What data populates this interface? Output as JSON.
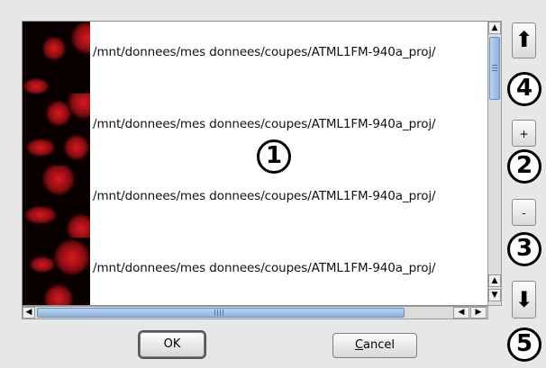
{
  "file_list": {
    "rows": [
      {
        "path": "/mnt/donnees/mes donnees/coupes/ATML1FM-940a_proj/"
      },
      {
        "path": "/mnt/donnees/mes donnees/coupes/ATML1FM-940a_proj/"
      },
      {
        "path": "/mnt/donnees/mes donnees/coupes/ATML1FM-940a_proj/"
      },
      {
        "path": "/mnt/donnees/mes donnees/coupes/ATML1FM-940a_proj/"
      }
    ]
  },
  "side_buttons": {
    "move_up": "⬆",
    "zoom_in": "+",
    "zoom_out": "-",
    "move_down": "⬇"
  },
  "callouts": [
    "1",
    "2",
    "3",
    "4",
    "5"
  ],
  "dialog": {
    "ok_label": "OK",
    "cancel_mnemonic": "C",
    "cancel_rest": "ancel"
  },
  "colors": {
    "thumbnail_bg": "#0a0000",
    "thumbnail_blob": "#c0161b",
    "scroll_thumb": "#a3c3e6"
  }
}
